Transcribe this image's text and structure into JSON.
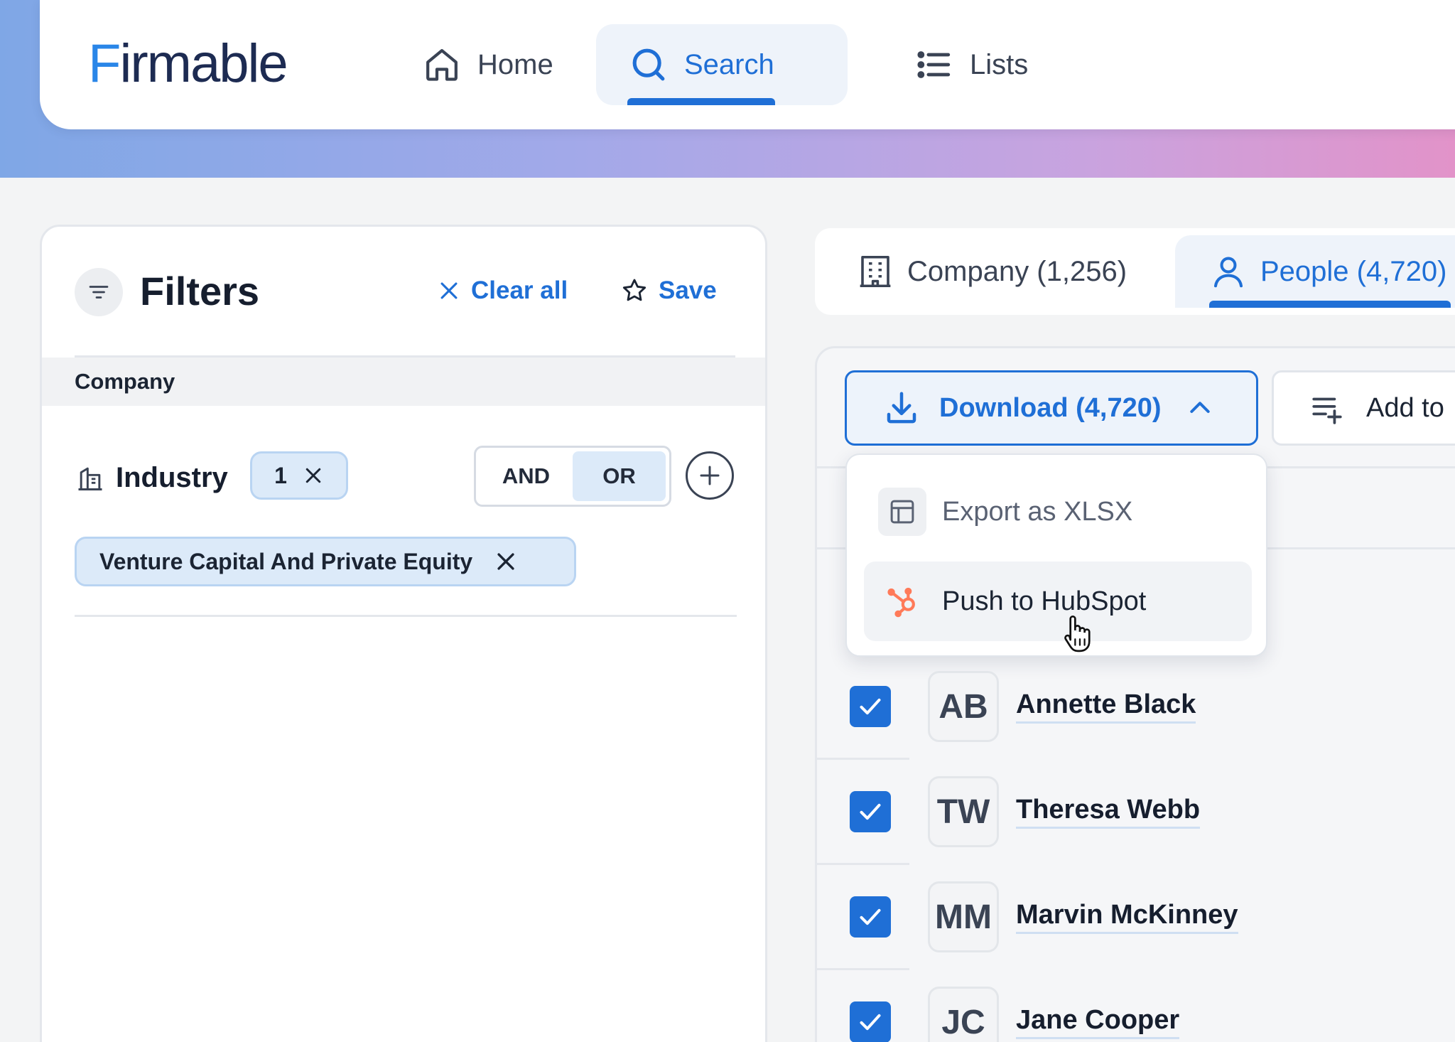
{
  "app": {
    "logo_text": "Firmable"
  },
  "nav": {
    "home": "Home",
    "search": "Search",
    "lists": "Lists"
  },
  "filters": {
    "title": "Filters",
    "clear_all": "Clear all",
    "save": "Save",
    "section": "Company",
    "industry": {
      "label": "Industry",
      "count": "1",
      "and_label": "AND",
      "or_label": "OR",
      "selected_operator": "OR",
      "value": "Venture Capital And Private Equity"
    }
  },
  "results": {
    "tabs": {
      "company": "Company (1,256)",
      "people": "People (4,720)"
    },
    "download_label": "Download (4,720)",
    "add_to_label": "Add to",
    "download_menu": {
      "export_xlsx": "Export as XLSX",
      "push_hubspot": "Push to HubSpot"
    },
    "people": [
      {
        "initials": "AB",
        "name": "Annette Black",
        "checked": true
      },
      {
        "initials": "TW",
        "name": "Theresa Webb",
        "checked": true
      },
      {
        "initials": "MM",
        "name": "Marvin McKinney",
        "checked": true
      },
      {
        "initials": "JC",
        "name": "Jane Cooper",
        "checked": true
      }
    ]
  },
  "colors": {
    "accent": "#1f6fd6",
    "chip_bg": "#dceaf9",
    "hubspot": "#ff7a59",
    "hero_gradient_start": "#7fa7e6",
    "hero_gradient_end": "#e293c9"
  }
}
